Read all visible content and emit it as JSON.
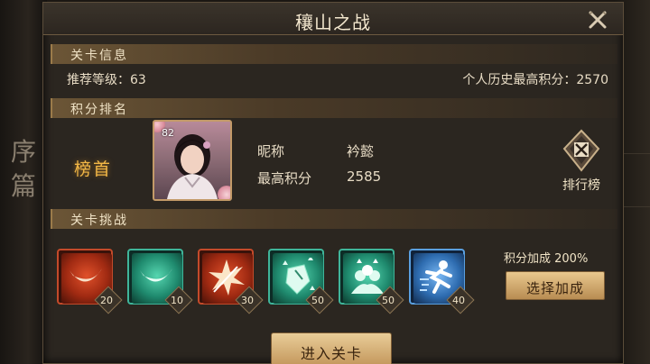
{
  "background": {
    "side_text": "序篇"
  },
  "dialog": {
    "title": "穰山之战",
    "close_icon": "close-x-icon"
  },
  "level_info": {
    "header": "关卡信息",
    "recommended_level_label": "推荐等级：",
    "recommended_level_value": "63",
    "personal_best_label": "个人历史最高积分：",
    "personal_best_value": "2570"
  },
  "ranking": {
    "header": "积分排名",
    "rank_title": "榜首",
    "top_player": {
      "level": "82",
      "nickname_label": "昵称",
      "nickname": "衿懿",
      "best_score_label": "最高积分",
      "best_score": "2585"
    },
    "leaderboard_label": "排行榜",
    "leaderboard_icon": "crossed-swords-shield-icon"
  },
  "challenge": {
    "header": "关卡挑战",
    "buffs": [
      {
        "icon": "crescent-slash-icon",
        "color": "#c44a2a",
        "value": "20"
      },
      {
        "icon": "crescent-slash-icon",
        "color": "#3fb59a",
        "value": "10"
      },
      {
        "icon": "burst-strike-icon",
        "color": "#c44a2a",
        "value": "30"
      },
      {
        "icon": "shield-up-icon",
        "color": "#3fb59a",
        "value": "50"
      },
      {
        "icon": "group-up-icon",
        "color": "#3fb59a",
        "value": "50"
      },
      {
        "icon": "running-figure-icon",
        "color": "#5aa0e0",
        "value": "40"
      }
    ],
    "bonus_text": "积分加成 200%",
    "select_bonus_label": "选择加成"
  },
  "enter_button_label": "进入关卡"
}
